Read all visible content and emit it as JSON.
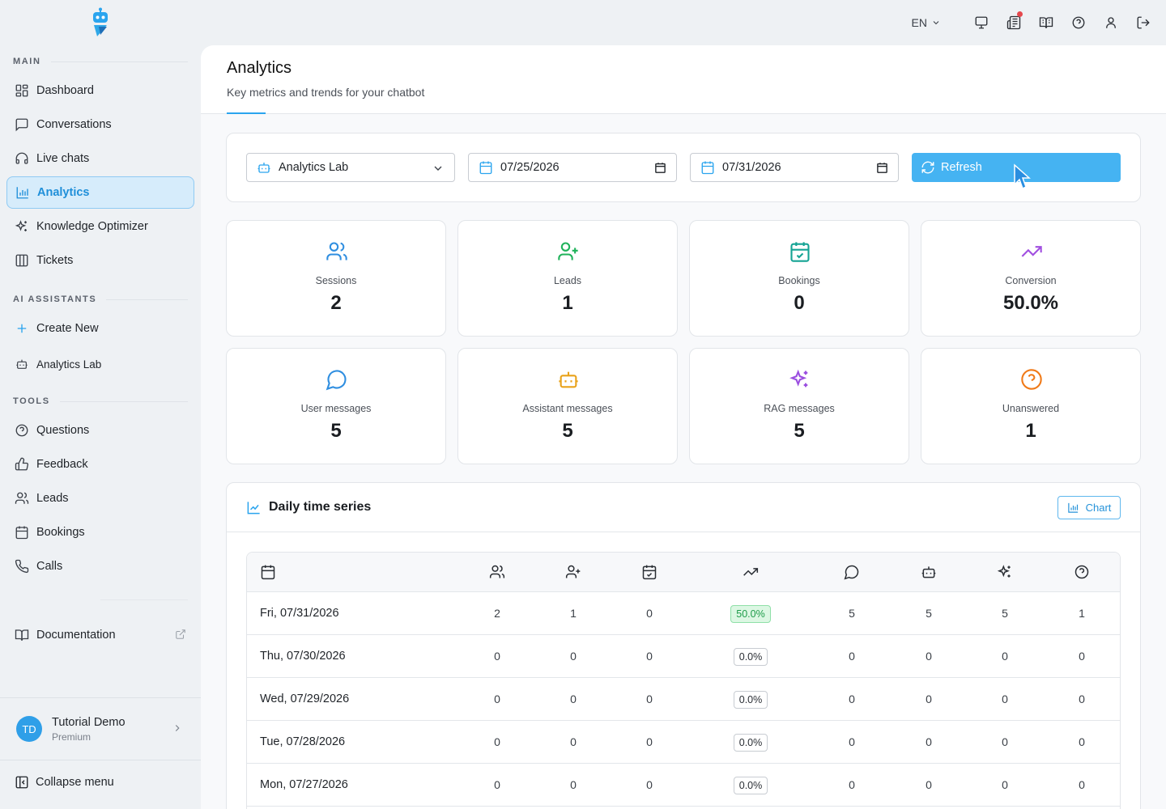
{
  "sidebar": {
    "sections": {
      "main": "MAIN",
      "ai": "AI ASSISTANTS",
      "tools": "TOOLS"
    },
    "main_items": [
      {
        "label": "Dashboard",
        "icon": "dashboard-icon"
      },
      {
        "label": "Conversations",
        "icon": "message-square-icon"
      },
      {
        "label": "Live chats",
        "icon": "headset-icon"
      },
      {
        "label": "Analytics",
        "icon": "bar-chart-icon",
        "active": true
      },
      {
        "label": "Knowledge Optimizer",
        "icon": "sparkles-icon"
      },
      {
        "label": "Tickets",
        "icon": "columns-icon"
      }
    ],
    "ai_items": [
      {
        "label": "Create New",
        "icon": "plus-icon"
      },
      {
        "label": "Analytics Lab",
        "icon": "bot-icon"
      }
    ],
    "tool_items": [
      {
        "label": "Questions",
        "icon": "question-circle-icon"
      },
      {
        "label": "Feedback",
        "icon": "thumbs-up-icon"
      },
      {
        "label": "Leads",
        "icon": "users-icon"
      },
      {
        "label": "Bookings",
        "icon": "calendar-icon"
      },
      {
        "label": "Calls",
        "icon": "phone-icon"
      }
    ],
    "documentation": "Documentation",
    "user": {
      "initials": "TD",
      "name": "Tutorial Demo",
      "plan": "Premium"
    },
    "collapse": "Collapse menu"
  },
  "topbar": {
    "language": "EN"
  },
  "colors": {
    "accent": "#45b3f2",
    "active_bg": "#d6ecfb",
    "positive": "#1e9c4a"
  },
  "header": {
    "title": "Analytics",
    "subtitle": "Key metrics and trends for your chatbot"
  },
  "filters": {
    "assistant": "Analytics Lab",
    "date_from": "07/25/2026",
    "date_to": "07/31/2026",
    "refresh": "Refresh"
  },
  "metrics": [
    {
      "label": "Sessions",
      "value": "2",
      "icon": "users-icon",
      "color": "#2f8ee0"
    },
    {
      "label": "Leads",
      "value": "1",
      "icon": "user-plus-icon",
      "color": "#1fb25a"
    },
    {
      "label": "Bookings",
      "value": "0",
      "icon": "calendar-check-icon",
      "color": "#14a394"
    },
    {
      "label": "Conversion",
      "value": "50.0%",
      "icon": "trending-up-icon",
      "color": "#a14fe0"
    },
    {
      "label": "User messages",
      "value": "5",
      "icon": "message-circle-icon",
      "color": "#2f8ee0"
    },
    {
      "label": "Assistant messages",
      "value": "5",
      "icon": "bot-icon",
      "color": "#e9a21a"
    },
    {
      "label": "RAG messages",
      "value": "5",
      "icon": "sparkles-icon",
      "color": "#9b4fe0"
    },
    {
      "label": "Unanswered",
      "value": "1",
      "icon": "question-circle-icon",
      "color": "#f07a18"
    }
  ],
  "timeseries": {
    "title": "Daily time series",
    "chart_button": "Chart",
    "columns": [
      "calendar-icon",
      "users-icon",
      "user-plus-icon",
      "calendar-check-icon",
      "trending-up-icon",
      "message-circle-icon",
      "bot-icon",
      "sparkles-icon",
      "question-circle-icon"
    ],
    "rows": [
      {
        "date": "Fri, 07/31/2026",
        "sessions": "2",
        "leads": "1",
        "bookings": "0",
        "conversion": "50.0%",
        "user": "5",
        "assistant": "5",
        "rag": "5",
        "unanswered": "1"
      },
      {
        "date": "Thu, 07/30/2026",
        "sessions": "0",
        "leads": "0",
        "bookings": "0",
        "conversion": "0.0%",
        "user": "0",
        "assistant": "0",
        "rag": "0",
        "unanswered": "0"
      },
      {
        "date": "Wed, 07/29/2026",
        "sessions": "0",
        "leads": "0",
        "bookings": "0",
        "conversion": "0.0%",
        "user": "0",
        "assistant": "0",
        "rag": "0",
        "unanswered": "0"
      },
      {
        "date": "Tue, 07/28/2026",
        "sessions": "0",
        "leads": "0",
        "bookings": "0",
        "conversion": "0.0%",
        "user": "0",
        "assistant": "0",
        "rag": "0",
        "unanswered": "0"
      },
      {
        "date": "Mon, 07/27/2026",
        "sessions": "0",
        "leads": "0",
        "bookings": "0",
        "conversion": "0.0%",
        "user": "0",
        "assistant": "0",
        "rag": "0",
        "unanswered": "0"
      }
    ]
  }
}
